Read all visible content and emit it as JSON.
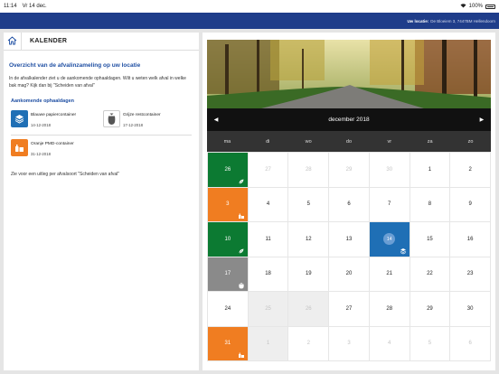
{
  "status": {
    "time": "11:14",
    "date": "Vr 14 dec.",
    "battery": "100%"
  },
  "topbar": {
    "label": "Uw locatie:",
    "address": "De Bloeiem 3, 7447BM Hellendoorn"
  },
  "leftpanel": {
    "title": "KALENDER",
    "heading": "Overzicht van de afvalinzameling op uw locatie",
    "intro": "In de afvalkalender ziet u de aankomende ophaaldagen. Wilt u weten welk afval in welke bak mag? Kijk dan bij \"Scheiden van afval\"",
    "upcoming_heading": "Aankomende ophaaldagen",
    "pickups": [
      {
        "name": "Blauwe papiercontainer",
        "date": "14-12-2018",
        "color": "#1f6fb5",
        "icon": "paper-icon"
      },
      {
        "name": "Grijze restcontainer",
        "date": "17-12-2018",
        "color": "#555555",
        "icon": "waste-bag-icon"
      },
      {
        "name": "Oranje PMD-container",
        "date": "31-12-2018",
        "color": "#f07d21",
        "icon": "pmd-icon"
      }
    ],
    "footer": "Zie voor een uitleg per afvalsoort \"Scheiden van afval\""
  },
  "calendar": {
    "month": "december 2018",
    "prev": "◀",
    "next": "▶",
    "weekdays": [
      "ma",
      "di",
      "wo",
      "do",
      "vr",
      "za",
      "zo"
    ],
    "colors": {
      "green": "#0c7a32",
      "orange": "#f07d21",
      "grey": "#8a8a8a",
      "blue": "#1f6fb5"
    },
    "weeks": [
      [
        {
          "d": "26",
          "t": "green",
          "m": "gft-icon"
        },
        {
          "d": "27",
          "t": "muted"
        },
        {
          "d": "28",
          "t": "muted"
        },
        {
          "d": "29",
          "t": "muted"
        },
        {
          "d": "30",
          "t": "muted"
        },
        {
          "d": "1"
        },
        {
          "d": "2"
        }
      ],
      [
        {
          "d": "3",
          "t": "orange",
          "m": "pmd-icon"
        },
        {
          "d": "4"
        },
        {
          "d": "5"
        },
        {
          "d": "6"
        },
        {
          "d": "7"
        },
        {
          "d": "8"
        },
        {
          "d": "9"
        }
      ],
      [
        {
          "d": "10",
          "t": "green",
          "m": "gft-icon"
        },
        {
          "d": "11"
        },
        {
          "d": "12"
        },
        {
          "d": "13"
        },
        {
          "d": "14",
          "t": "blue",
          "m": "paper-icon",
          "today": true
        },
        {
          "d": "15"
        },
        {
          "d": "16"
        }
      ],
      [
        {
          "d": "17",
          "t": "grey",
          "m": "waste-bag-icon"
        },
        {
          "d": "18"
        },
        {
          "d": "19"
        },
        {
          "d": "20"
        },
        {
          "d": "21"
        },
        {
          "d": "22"
        },
        {
          "d": "23"
        }
      ],
      [
        {
          "d": "24"
        },
        {
          "d": "25",
          "t": "muted-grey"
        },
        {
          "d": "26",
          "t": "muted-grey"
        },
        {
          "d": "27"
        },
        {
          "d": "28"
        },
        {
          "d": "29"
        },
        {
          "d": "30"
        }
      ],
      [
        {
          "d": "31",
          "t": "orange",
          "m": "pmd-icon"
        },
        {
          "d": "1",
          "t": "muted-grey"
        },
        {
          "d": "2",
          "t": "muted"
        },
        {
          "d": "3",
          "t": "muted"
        },
        {
          "d": "4",
          "t": "muted"
        },
        {
          "d": "5",
          "t": "muted"
        },
        {
          "d": "6",
          "t": "muted"
        }
      ]
    ]
  }
}
